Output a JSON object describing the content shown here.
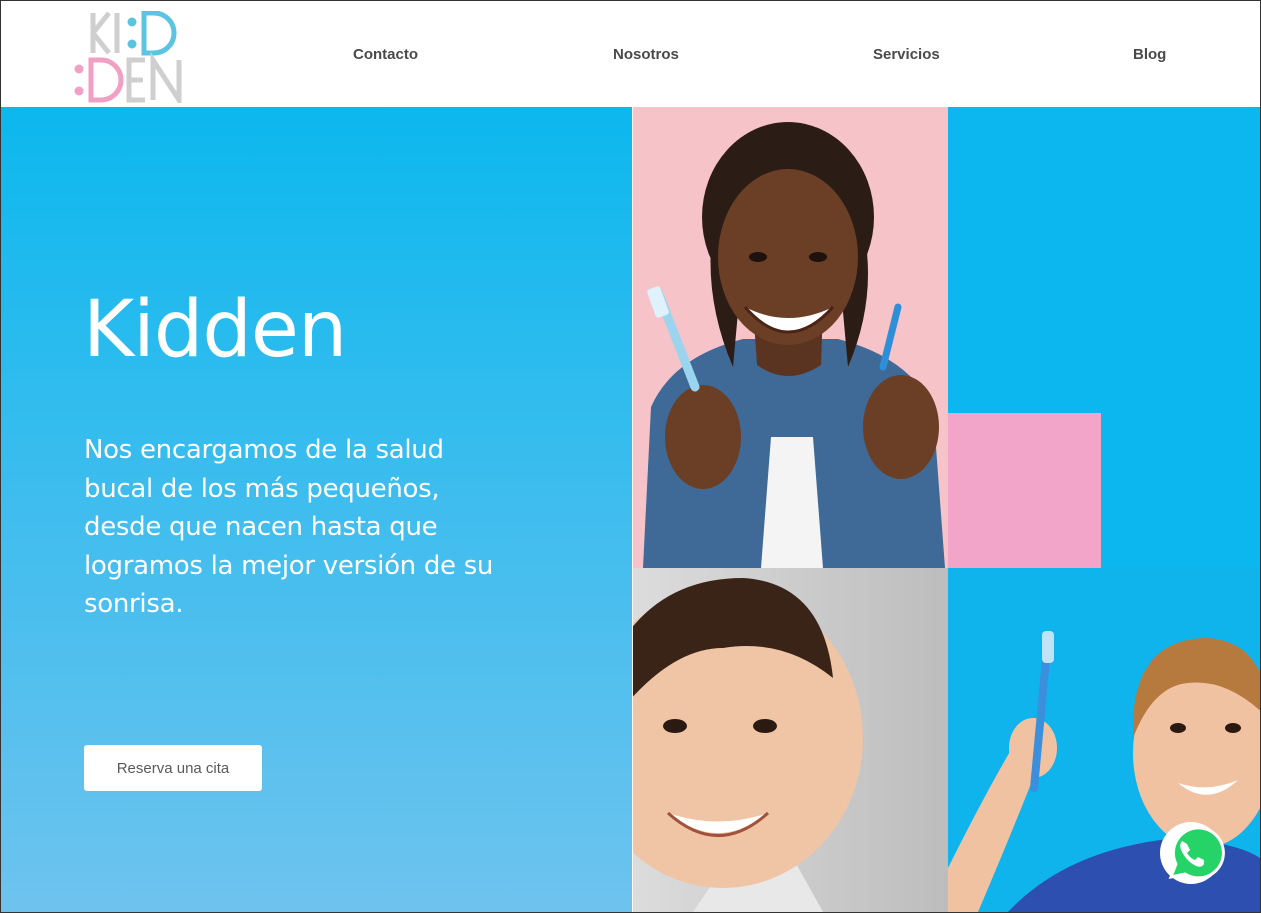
{
  "brand": {
    "logo_top": "KI:D",
    "logo_bottom": ":DEN",
    "logo_gray": "#cfcfcf",
    "logo_blue": "#5bc4e0",
    "logo_pink": "#f0a0c4"
  },
  "nav": {
    "items": [
      "Contacto",
      "Nosotros",
      "Servicios",
      "Blog"
    ]
  },
  "hero": {
    "title": "Kidden",
    "description": "Nos encargamos de la salud bucal de los más pequeños, desde que nacen hasta que logramos la mejor versión de su sonrisa.",
    "cta_label": "Reserva una cita"
  },
  "colors": {
    "hero_blue": "#0bb8ee",
    "tile_pink": "#f6c3c8",
    "accent_pink": "#f2a4c9",
    "whatsapp_green": "#25d366"
  },
  "icons": {
    "chat": "whatsapp-icon"
  }
}
